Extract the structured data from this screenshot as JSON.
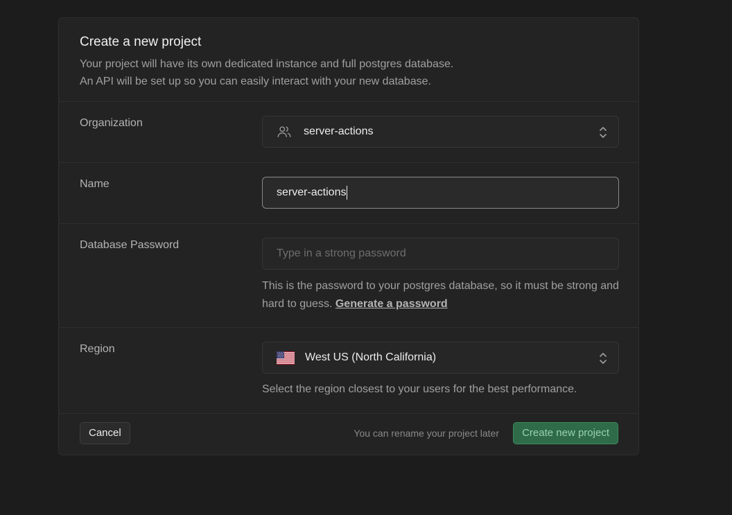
{
  "dialog": {
    "title": "Create a new project",
    "description_line1": "Your project will have its own dedicated instance and full postgres database.",
    "description_line2": "An API will be set up so you can easily interact with your new database."
  },
  "organization": {
    "label": "Organization",
    "value": "server-actions",
    "icon": "users-icon"
  },
  "name": {
    "label": "Name",
    "value": "server-actions"
  },
  "password": {
    "label": "Database Password",
    "placeholder": "Type in a strong password",
    "helper_text": "This is the password to your postgres database, so it must be strong and hard to guess.",
    "generate_link": "Generate a password"
  },
  "region": {
    "label": "Region",
    "value": "West US (North California)",
    "icon": "us-flag-icon",
    "helper_text": "Select the region closest to your users for the best performance."
  },
  "footer": {
    "cancel_label": "Cancel",
    "rename_note": "You can rename your project later",
    "create_label": "Create new project"
  },
  "colors": {
    "background": "#1c1c1c",
    "card": "#232323",
    "accent": "#2f6b48",
    "accent_text": "#9ad0b0"
  }
}
